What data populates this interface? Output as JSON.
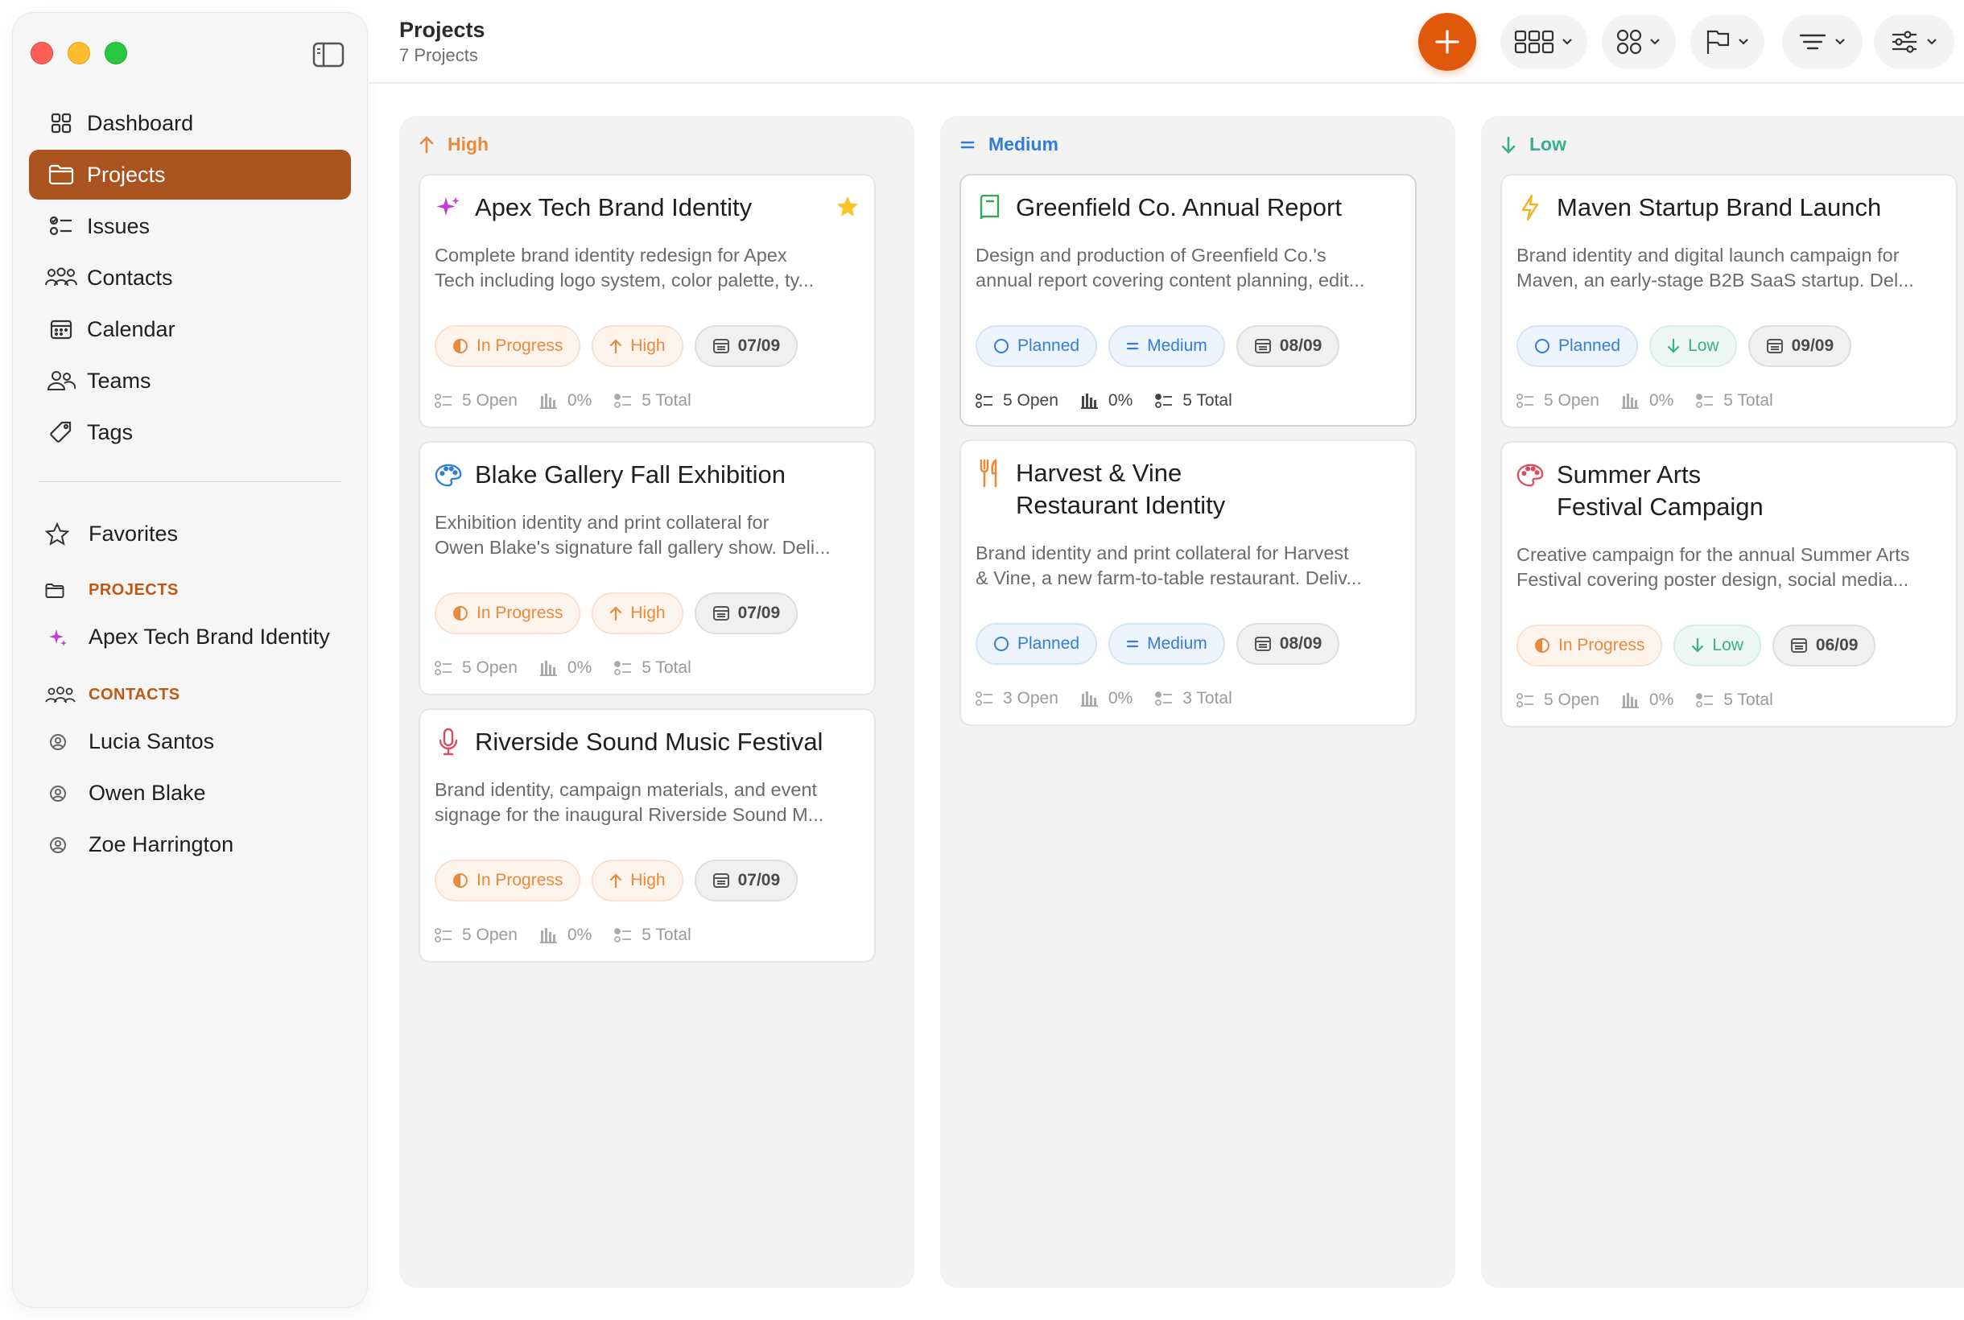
{
  "sidebar": {
    "nav": [
      {
        "label": "Dashboard",
        "icon": "grid-icon"
      },
      {
        "label": "Projects",
        "icon": "folder-icon",
        "active": true
      },
      {
        "label": "Issues",
        "icon": "checklist-icon"
      },
      {
        "label": "Contacts",
        "icon": "people-icon"
      },
      {
        "label": "Calendar",
        "icon": "calendar-icon"
      },
      {
        "label": "Teams",
        "icon": "team-icon"
      },
      {
        "label": "Tags",
        "icon": "tag-icon"
      }
    ],
    "favorites_label": "Favorites",
    "projects_heading": "PROJECTS",
    "favorite_project": "Apex Tech Brand Identity",
    "contacts_heading": "CONTACTS",
    "contacts": [
      "Lucia Santos",
      "Owen Blake",
      "Zoe Harrington"
    ]
  },
  "header": {
    "title": "Projects",
    "subtitle": "7 Projects"
  },
  "colors": {
    "accent": "#ab531f",
    "add_button": "#e0580c",
    "high": "#e88a3e",
    "medium": "#2f7ddd",
    "low": "#3aae8f"
  },
  "columns": [
    {
      "title": "High",
      "cards": [
        {
          "title": "Apex Tech Brand Identity",
          "icon": "sparkle-icon",
          "favorite": true,
          "desc": [
            "Complete brand identity redesign for Apex",
            "Tech including logo system, color palette, ty..."
          ],
          "status": "In Progress",
          "priority": "High",
          "date": "07/09",
          "open": "5 Open",
          "progress": "0%",
          "total": "5 Total"
        },
        {
          "title": "Blake Gallery Fall Exhibition",
          "icon": "palette-icon",
          "desc": [
            "Exhibition identity and print collateral for",
            "Owen Blake's signature fall gallery show. Deli..."
          ],
          "status": "In Progress",
          "priority": "High",
          "date": "07/09",
          "open": "5 Open",
          "progress": "0%",
          "total": "5 Total"
        },
        {
          "title": "Riverside Sound Music Festival",
          "icon": "microphone-icon",
          "desc": [
            "Brand identity, campaign materials, and event",
            "signage for the inaugural Riverside Sound M..."
          ],
          "status": "In Progress",
          "priority": "High",
          "date": "07/09",
          "open": "5 Open",
          "progress": "0%",
          "total": "5 Total"
        }
      ]
    },
    {
      "title": "Medium",
      "cards": [
        {
          "title": "Greenfield Co. Annual Report",
          "icon": "book-icon",
          "desc": [
            "Design and production of Greenfield Co.'s",
            "annual report covering content planning, edit..."
          ],
          "status": "Planned",
          "priority": "Medium",
          "date": "08/09",
          "open": "5 Open",
          "progress": "0%",
          "total": "5 Total"
        },
        {
          "title_lines": [
            "Harvest & Vine",
            "Restaurant Identity"
          ],
          "icon": "fork-knife-icon",
          "desc": [
            "Brand identity and print collateral for Harvest",
            "& Vine, a new farm-to-table restaurant. Deliv..."
          ],
          "status": "Planned",
          "priority": "Medium",
          "date": "08/09",
          "open": "3 Open",
          "progress": "0%",
          "total": "3 Total"
        }
      ]
    },
    {
      "title": "Low",
      "cards": [
        {
          "title": "Maven Startup Brand Launch",
          "icon": "bolt-icon",
          "desc": [
            "Brand identity and digital launch campaign for",
            "Maven, an early-stage B2B SaaS startup. Del..."
          ],
          "status": "Planned",
          "priority": "Low",
          "date": "09/09",
          "open": "5 Open",
          "progress": "0%",
          "total": "5 Total"
        },
        {
          "title_lines": [
            "Summer Arts",
            "Festival Campaign"
          ],
          "icon": "palette-icon",
          "desc": [
            "Creative campaign for the annual Summer Arts",
            "Festival covering poster design, social media..."
          ],
          "status": "In Progress",
          "priority": "Low",
          "date": "06/09",
          "open": "5 Open",
          "progress": "0%",
          "total": "5 Total"
        }
      ]
    }
  ]
}
